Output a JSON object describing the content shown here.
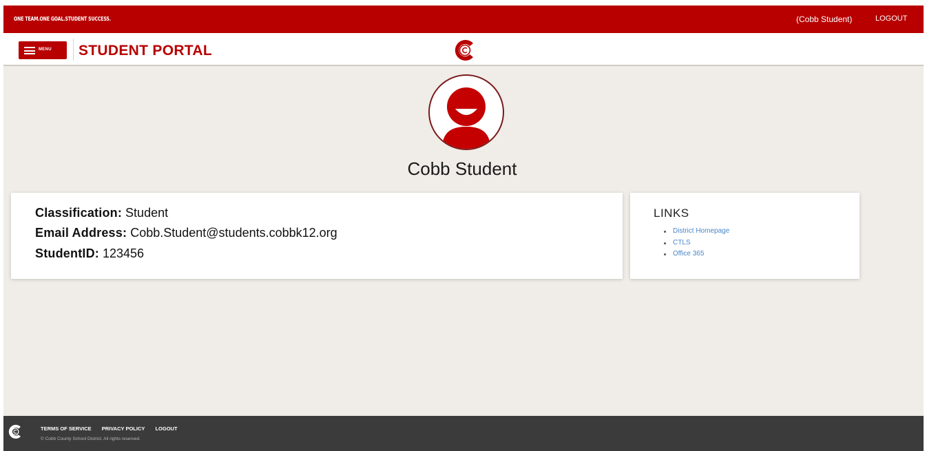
{
  "topbar": {
    "tagline": "ONE TEAM.ONE GOAL.STUDENT SUCCESS.",
    "user_name": "(Cobb Student)",
    "logout_label": "LOGOUT"
  },
  "header": {
    "menu_label": "MENU",
    "portal_title": "STUDENT PORTAL",
    "logo_icon": "cobb-c-logo-icon"
  },
  "profile": {
    "name": "Cobb Student",
    "avatar_icon": "user-avatar-icon"
  },
  "info": {
    "classification_label": "Classification:",
    "classification_value": "Student",
    "email_label": "Email Address:",
    "email_value": "Cobb.Student@students.cobbk12.org",
    "studentid_label": "StudentID:",
    "studentid_value": "123456"
  },
  "links": {
    "title": "LINKS",
    "items": [
      "District Homepage",
      "CTLS",
      "Office 365"
    ]
  },
  "footer": {
    "terms_label": "TERMS OF SERVICE",
    "privacy_label": "PRIVACY POLICY",
    "logout_label": "LOGOUT",
    "copyright": "© Cobb County School District. All rights reserved."
  },
  "colors": {
    "brand_red": "#b80000",
    "background": "#f0ece8",
    "footer_bg": "#3b3b3b",
    "link_blue": "#4a86c8"
  }
}
